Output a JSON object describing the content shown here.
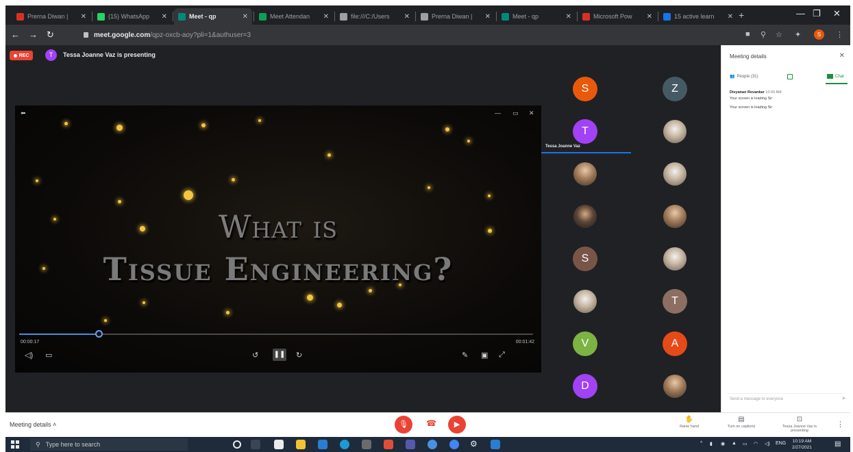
{
  "browser": {
    "tabs": [
      {
        "label": "Prerna Diwan |",
        "favicon_color": "#d93025",
        "active": false
      },
      {
        "label": "(15) WhatsApp",
        "favicon_color": "#25d366",
        "active": false
      },
      {
        "label": "Meet - qp",
        "favicon_color": "#00897b",
        "active": true
      },
      {
        "label": "Meet Attendan",
        "favicon_color": "#0f9d58",
        "active": false
      },
      {
        "label": "file:///C:/Users",
        "favicon_color": "#9aa0a6",
        "active": false
      },
      {
        "label": "Prerna Diwan |",
        "favicon_color": "#9aa0a6",
        "active": false
      },
      {
        "label": "Meet - qp",
        "favicon_color": "#00897b",
        "active": false
      },
      {
        "label": "Microsoft Pow",
        "favicon_color": "#d93025",
        "active": false
      },
      {
        "label": "15 active learn",
        "favicon_color": "#1a73e8",
        "active": false
      }
    ],
    "url_host": "meet.google.com",
    "url_path": "/qpz-oxcb-aoy?pli=1&authuser=3",
    "profile_initial": "S"
  },
  "meet": {
    "rec_label": "REC",
    "presenter_initial": "T",
    "presenter_text": "Tessa Joanne Vaz is presenting"
  },
  "video": {
    "title_line1": "What is",
    "title_line2": "Tissue Engineering?",
    "time_current": "00:00:17",
    "time_duration": "00:01:42",
    "progress": 0.155
  },
  "participants": [
    {
      "type": "initial",
      "initial": "S",
      "color": "#e8590c"
    },
    {
      "type": "initial",
      "initial": "Z",
      "color": "#455a64"
    },
    {
      "type": "initial",
      "initial": "T",
      "color": "#a142f4",
      "name": "Tessa Joanne Vaz",
      "active": true
    },
    {
      "type": "photo",
      "style": "light"
    },
    {
      "type": "photo",
      "style": "normal"
    },
    {
      "type": "photo",
      "style": "light"
    },
    {
      "type": "photo",
      "style": "dark"
    },
    {
      "type": "photo",
      "style": "normal"
    },
    {
      "type": "initial",
      "initial": "S",
      "color": "#795548"
    },
    {
      "type": "photo",
      "style": "light"
    },
    {
      "type": "photo",
      "style": "light"
    },
    {
      "type": "initial",
      "initial": "T",
      "color": "#8d6e63"
    },
    {
      "type": "initial",
      "initial": "V",
      "color": "#7cb342"
    },
    {
      "type": "initial",
      "initial": "A",
      "color": "#e64a19"
    },
    {
      "type": "initial",
      "initial": "D",
      "color": "#a142f4"
    },
    {
      "type": "photo",
      "style": "normal"
    }
  ],
  "panel": {
    "title": "Meeting details",
    "people_tab": "People (31)",
    "chat_tab": "Chat",
    "chat_sender": "Divyanan Revankar",
    "chat_time": "10:00 AM",
    "chat_messages": [
      "Your screen is loading Sir",
      "Your screen is loading Sir"
    ],
    "input_placeholder": "Send a message to everyone"
  },
  "controls": {
    "meeting_details_label": "Meeting details",
    "raise_hand": "Raise hand",
    "captions": "Turn on captions",
    "presenting": "Tessa Joanne Vaz is presenting"
  },
  "taskbar": {
    "search_placeholder": "Type here to search",
    "language": "ENG",
    "time": "10:19 AM",
    "date": "2/27/2021"
  }
}
